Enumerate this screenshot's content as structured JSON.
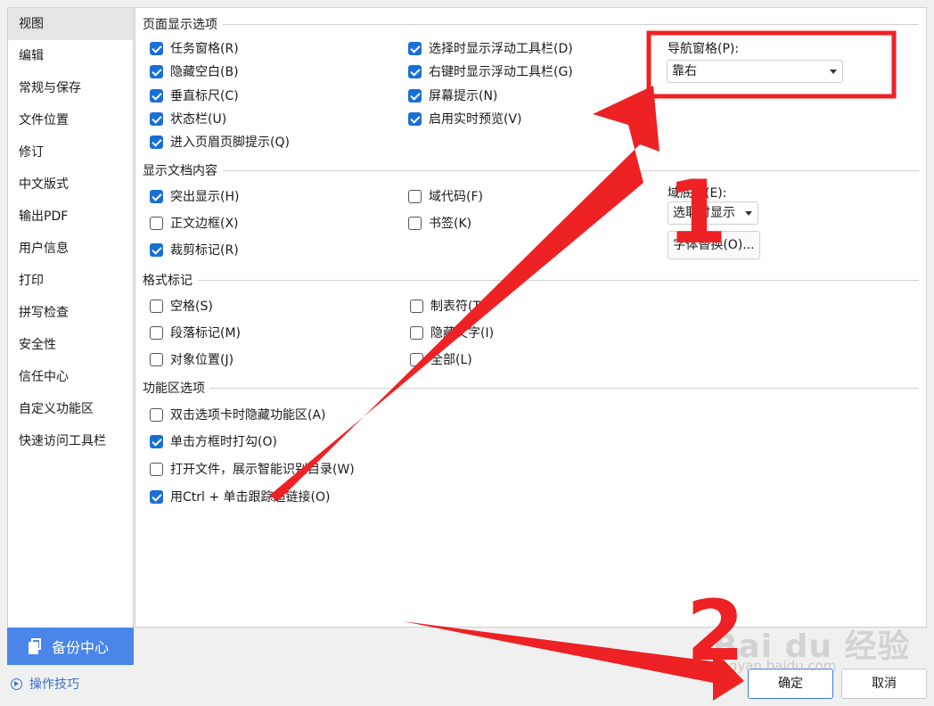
{
  "sidebar": {
    "items": [
      "视图",
      "编辑",
      "常规与保存",
      "文件位置",
      "修订",
      "中文版式",
      "输出PDF",
      "用户信息",
      "打印",
      "拼写检查",
      "安全性",
      "信任中心",
      "自定义功能区",
      "快速访问工具栏"
    ],
    "active_index": 0,
    "backup_label": "备份中心",
    "tips_label": "操作技巧"
  },
  "sections": {
    "page_display": "页面显示选项",
    "doc_content": "显示文档内容",
    "format_marks": "格式标记",
    "ribbon": "功能区选项"
  },
  "page_display": {
    "left": [
      {
        "label": "任务窗格(R)",
        "checked": true
      },
      {
        "label": "隐藏空白(B)",
        "checked": true
      },
      {
        "label": "垂直标尺(C)",
        "checked": true
      },
      {
        "label": "状态栏(U)",
        "checked": true
      },
      {
        "label": "进入页眉页脚提示(Q)",
        "checked": true
      }
    ],
    "middle": [
      {
        "label": "选择时显示浮动工具栏(D)",
        "checked": true
      },
      {
        "label": "右键时显示浮动工具栏(G)",
        "checked": true
      },
      {
        "label": "屏幕提示(N)",
        "checked": true
      },
      {
        "label": "启用实时预览(V)",
        "checked": true
      }
    ],
    "nav_pane_label": "导航窗格(P):",
    "nav_pane_value": "靠右"
  },
  "doc_content": {
    "left": [
      {
        "label": "突出显示(H)",
        "checked": true
      },
      {
        "label": "正文边框(X)",
        "checked": false
      },
      {
        "label": "裁剪标记(R)",
        "checked": true
      }
    ],
    "middle": [
      {
        "label": "域代码(F)",
        "checked": false
      },
      {
        "label": "书签(K)",
        "checked": false
      }
    ],
    "field_shading_label": "域底纹(E):",
    "field_shading_value": "选取时显示",
    "font_sub_button": "字体替换(O)..."
  },
  "format_marks": {
    "left": [
      {
        "label": "空格(S)",
        "checked": false
      },
      {
        "label": "段落标记(M)",
        "checked": false
      },
      {
        "label": "对象位置(J)",
        "checked": false
      }
    ],
    "middle": [
      {
        "label": "制表符(T)",
        "checked": false
      },
      {
        "label": "隐藏文字(I)",
        "checked": false
      },
      {
        "label": "全部(L)",
        "checked": false
      }
    ]
  },
  "ribbon": {
    "items": [
      {
        "label": "双击选项卡时隐藏功能区(A)",
        "checked": false
      },
      {
        "label": "单击方框时打勾(O)",
        "checked": true
      },
      {
        "label": "打开文件，展示智能识别目录(W)",
        "checked": false
      },
      {
        "label": "用Ctrl + 单击跟踪超链接(O)",
        "checked": true
      }
    ]
  },
  "footer": {
    "ok_label": "确定",
    "cancel_label": "取消"
  },
  "annotations": {
    "number_1": "1",
    "number_2": "2",
    "color": "#ee2124",
    "watermark": "Bai du 经验",
    "watermark_url": "jingyan.baidu.com"
  },
  "colors": {
    "accent": "#1a6fd4",
    "sidebar_button": "#4a86e8",
    "link": "#3b6fc8"
  }
}
